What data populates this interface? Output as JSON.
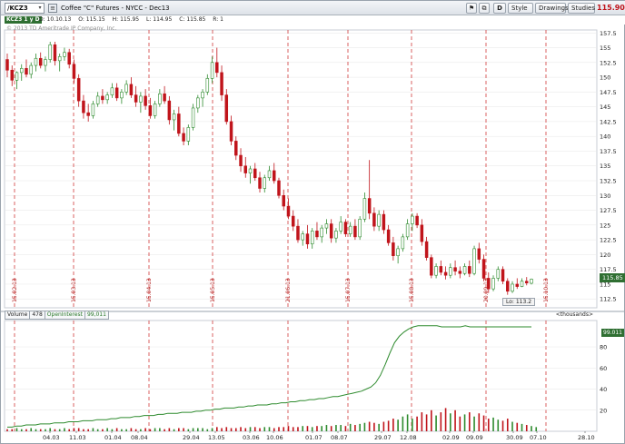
{
  "toolbar": {
    "symbol": "/KCZ3",
    "symbol_dropdown_icon": "chevron-down-icon",
    "company_icon": "company-profile-icon",
    "instrument_description": "Coffee \"C\" Futures - NYCC - Dec13",
    "d_label": "D",
    "style_label": "Style",
    "drawings_label": "Drawings",
    "studies_label": "Studies",
    "last_price": "115.90",
    "last_price_color": "#c0141b"
  },
  "quote_line": {
    "study_tag": "KCZ3 1 y D",
    "date": "D: 10.10.13",
    "open": "O: 115.15",
    "high": "H: 115.95",
    "low": "L: 114.95",
    "close": "C: 115.85",
    "range": "R: 1"
  },
  "copyright": "© 2013 TD Ameritrade IP Company, Inc.",
  "price_axis": {
    "ticks": [
      "157.5",
      "155",
      "152.5",
      "150",
      "147.5",
      "145",
      "142.5",
      "140",
      "137.5",
      "135",
      "132.5",
      "130",
      "127.5",
      "125",
      "122.5",
      "120",
      "117.5",
      "115",
      "112.5"
    ],
    "current_price_badge": "115.85",
    "low_badge": "Lo: 113.2"
  },
  "date_markers": [
    "15.02.13",
    "15.03.13",
    "15.04.13",
    "15.05.13",
    "21.06.13",
    "15.07.13",
    "15.08.13",
    "20.09.13",
    "15.10.13"
  ],
  "volume_panel": {
    "volume_label": "Volume",
    "volume_value": "478",
    "oi_label": "OpenInterest",
    "oi_value": "99,011",
    "thousands_label": "<thousands>",
    "oi_badge": "99.011",
    "y_ticks": [
      "80",
      "60",
      "40",
      "20"
    ]
  },
  "x_axis": {
    "labels": [
      "04.03",
      "11.03",
      "01.04",
      "08.04",
      "29.04",
      "13.05",
      "03.06",
      "10.06",
      "01.07",
      "08.07",
      "29.07",
      "12.08",
      "02.09",
      "09.09",
      "30.09",
      "07.10",
      "28.10"
    ]
  },
  "colors": {
    "up": "#2e8b2e",
    "down": "#c0141b",
    "oi_line": "#2e8b2e",
    "marker": "#d23a3a",
    "grid": "#e6e6e6"
  },
  "chart_data": {
    "type": "candlestick",
    "title": "Coffee \"C\" Futures - NYCC - Dec13",
    "ylim": [
      111,
      158
    ],
    "candles": [
      {
        "o": 153.0,
        "h": 154.0,
        "l": 150.0,
        "c": 151.2
      },
      {
        "o": 151.2,
        "h": 152.0,
        "l": 148.5,
        "c": 149.5
      },
      {
        "o": 149.5,
        "h": 151.0,
        "l": 148.0,
        "c": 150.8
      },
      {
        "o": 150.8,
        "h": 152.2,
        "l": 149.4,
        "c": 151.5
      },
      {
        "o": 151.5,
        "h": 153.0,
        "l": 150.0,
        "c": 150.5
      },
      {
        "o": 150.5,
        "h": 152.5,
        "l": 149.8,
        "c": 152.0
      },
      {
        "o": 152.0,
        "h": 154.0,
        "l": 151.0,
        "c": 153.2
      },
      {
        "o": 153.2,
        "h": 154.2,
        "l": 151.5,
        "c": 152.0
      },
      {
        "o": 152.0,
        "h": 153.5,
        "l": 151.0,
        "c": 153.0
      },
      {
        "o": 153.0,
        "h": 156.0,
        "l": 152.5,
        "c": 155.5
      },
      {
        "o": 155.5,
        "h": 156.0,
        "l": 152.0,
        "c": 152.8
      },
      {
        "o": 152.8,
        "h": 154.0,
        "l": 151.0,
        "c": 153.5
      },
      {
        "o": 153.5,
        "h": 155.0,
        "l": 152.8,
        "c": 154.2
      },
      {
        "o": 154.2,
        "h": 154.8,
        "l": 151.5,
        "c": 152.2
      },
      {
        "o": 152.2,
        "h": 153.0,
        "l": 149.0,
        "c": 149.8
      },
      {
        "o": 149.8,
        "h": 150.5,
        "l": 145.0,
        "c": 146.0
      },
      {
        "o": 146.0,
        "h": 147.0,
        "l": 143.0,
        "c": 144.0
      },
      {
        "o": 144.0,
        "h": 145.5,
        "l": 142.5,
        "c": 143.5
      },
      {
        "o": 143.5,
        "h": 146.0,
        "l": 143.0,
        "c": 145.5
      },
      {
        "o": 145.5,
        "h": 147.5,
        "l": 145.0,
        "c": 146.8
      },
      {
        "o": 146.8,
        "h": 148.0,
        "l": 145.5,
        "c": 146.2
      },
      {
        "o": 146.2,
        "h": 147.5,
        "l": 145.5,
        "c": 147.0
      },
      {
        "o": 147.0,
        "h": 149.0,
        "l": 146.5,
        "c": 148.2
      },
      {
        "o": 148.2,
        "h": 149.0,
        "l": 146.0,
        "c": 146.5
      },
      {
        "o": 146.5,
        "h": 148.0,
        "l": 145.5,
        "c": 147.5
      },
      {
        "o": 147.5,
        "h": 149.5,
        "l": 147.0,
        "c": 148.8
      },
      {
        "o": 148.8,
        "h": 150.0,
        "l": 146.5,
        "c": 147.0
      },
      {
        "o": 147.0,
        "h": 148.5,
        "l": 145.0,
        "c": 145.8
      },
      {
        "o": 145.8,
        "h": 147.5,
        "l": 144.0,
        "c": 146.8
      },
      {
        "o": 146.8,
        "h": 148.0,
        "l": 144.5,
        "c": 145.2
      },
      {
        "o": 145.2,
        "h": 146.5,
        "l": 143.0,
        "c": 143.5
      },
      {
        "o": 143.5,
        "h": 146.0,
        "l": 143.0,
        "c": 145.5
      },
      {
        "o": 145.5,
        "h": 148.0,
        "l": 145.0,
        "c": 147.2
      },
      {
        "o": 147.2,
        "h": 148.5,
        "l": 145.5,
        "c": 146.0
      },
      {
        "o": 146.0,
        "h": 146.8,
        "l": 142.0,
        "c": 142.8
      },
      {
        "o": 142.8,
        "h": 144.5,
        "l": 141.0,
        "c": 143.8
      },
      {
        "o": 143.8,
        "h": 145.0,
        "l": 140.0,
        "c": 140.5
      },
      {
        "o": 140.5,
        "h": 141.5,
        "l": 138.5,
        "c": 139.2
      },
      {
        "o": 139.2,
        "h": 142.0,
        "l": 138.5,
        "c": 141.5
      },
      {
        "o": 141.5,
        "h": 145.5,
        "l": 141.0,
        "c": 144.8
      },
      {
        "o": 144.8,
        "h": 147.0,
        "l": 144.0,
        "c": 146.5
      },
      {
        "o": 146.5,
        "h": 148.0,
        "l": 145.0,
        "c": 147.5
      },
      {
        "o": 147.5,
        "h": 150.5,
        "l": 147.0,
        "c": 149.8
      },
      {
        "o": 149.8,
        "h": 153.5,
        "l": 149.0,
        "c": 152.5
      },
      {
        "o": 152.5,
        "h": 155.0,
        "l": 150.0,
        "c": 150.8
      },
      {
        "o": 150.8,
        "h": 152.0,
        "l": 146.0,
        "c": 147.0
      },
      {
        "o": 147.0,
        "h": 148.0,
        "l": 142.0,
        "c": 142.5
      },
      {
        "o": 142.5,
        "h": 143.5,
        "l": 138.5,
        "c": 139.2
      },
      {
        "o": 139.2,
        "h": 140.0,
        "l": 136.0,
        "c": 136.8
      },
      {
        "o": 136.8,
        "h": 138.0,
        "l": 134.0,
        "c": 135.0
      },
      {
        "o": 135.0,
        "h": 136.5,
        "l": 133.0,
        "c": 133.8
      },
      {
        "o": 133.8,
        "h": 135.0,
        "l": 132.0,
        "c": 134.5
      },
      {
        "o": 134.5,
        "h": 135.5,
        "l": 132.5,
        "c": 133.0
      },
      {
        "o": 133.0,
        "h": 134.0,
        "l": 130.5,
        "c": 131.2
      },
      {
        "o": 131.2,
        "h": 133.5,
        "l": 130.5,
        "c": 133.0
      },
      {
        "o": 133.0,
        "h": 135.0,
        "l": 132.5,
        "c": 134.2
      },
      {
        "o": 134.2,
        "h": 135.5,
        "l": 132.0,
        "c": 132.5
      },
      {
        "o": 132.5,
        "h": 133.0,
        "l": 129.5,
        "c": 130.0
      },
      {
        "o": 130.0,
        "h": 131.0,
        "l": 127.5,
        "c": 128.2
      },
      {
        "o": 128.2,
        "h": 129.5,
        "l": 126.0,
        "c": 126.5
      },
      {
        "o": 126.5,
        "h": 127.5,
        "l": 124.0,
        "c": 124.8
      },
      {
        "o": 124.8,
        "h": 126.0,
        "l": 122.0,
        "c": 122.5
      },
      {
        "o": 122.5,
        "h": 124.0,
        "l": 121.5,
        "c": 123.5
      },
      {
        "o": 123.5,
        "h": 125.0,
        "l": 121.0,
        "c": 121.8
      },
      {
        "o": 121.8,
        "h": 124.5,
        "l": 121.0,
        "c": 124.0
      },
      {
        "o": 124.0,
        "h": 125.5,
        "l": 122.5,
        "c": 123.0
      },
      {
        "o": 123.0,
        "h": 125.0,
        "l": 122.0,
        "c": 124.5
      },
      {
        "o": 124.5,
        "h": 126.0,
        "l": 123.5,
        "c": 125.2
      },
      {
        "o": 125.2,
        "h": 126.0,
        "l": 122.0,
        "c": 122.8
      },
      {
        "o": 122.8,
        "h": 124.5,
        "l": 122.0,
        "c": 124.0
      },
      {
        "o": 124.0,
        "h": 126.5,
        "l": 123.5,
        "c": 125.5
      },
      {
        "o": 125.5,
        "h": 126.0,
        "l": 123.0,
        "c": 123.5
      },
      {
        "o": 123.5,
        "h": 125.5,
        "l": 123.0,
        "c": 124.8
      },
      {
        "o": 124.8,
        "h": 126.0,
        "l": 122.5,
        "c": 123.0
      },
      {
        "o": 123.0,
        "h": 126.5,
        "l": 122.5,
        "c": 126.0
      },
      {
        "o": 126.0,
        "h": 130.5,
        "l": 125.5,
        "c": 129.5
      },
      {
        "o": 129.5,
        "h": 136.0,
        "l": 126.0,
        "c": 127.0
      },
      {
        "o": 127.0,
        "h": 128.0,
        "l": 124.0,
        "c": 124.8
      },
      {
        "o": 124.8,
        "h": 127.5,
        "l": 124.0,
        "c": 126.8
      },
      {
        "o": 126.8,
        "h": 127.5,
        "l": 123.5,
        "c": 124.2
      },
      {
        "o": 124.2,
        "h": 125.0,
        "l": 121.5,
        "c": 122.0
      },
      {
        "o": 122.0,
        "h": 123.0,
        "l": 119.0,
        "c": 119.8
      },
      {
        "o": 119.8,
        "h": 121.5,
        "l": 118.5,
        "c": 121.0
      },
      {
        "o": 121.0,
        "h": 123.5,
        "l": 120.5,
        "c": 123.0
      },
      {
        "o": 123.0,
        "h": 126.0,
        "l": 122.5,
        "c": 125.2
      },
      {
        "o": 125.2,
        "h": 127.0,
        "l": 124.0,
        "c": 126.5
      },
      {
        "o": 126.5,
        "h": 127.0,
        "l": 124.5,
        "c": 125.0
      },
      {
        "o": 125.0,
        "h": 126.0,
        "l": 121.5,
        "c": 122.2
      },
      {
        "o": 122.2,
        "h": 123.0,
        "l": 119.0,
        "c": 119.5
      },
      {
        "o": 119.5,
        "h": 120.0,
        "l": 116.0,
        "c": 116.5
      },
      {
        "o": 116.5,
        "h": 118.5,
        "l": 116.0,
        "c": 118.0
      },
      {
        "o": 118.0,
        "h": 119.0,
        "l": 116.5,
        "c": 117.0
      },
      {
        "o": 117.0,
        "h": 118.0,
        "l": 115.8,
        "c": 116.5
      },
      {
        "o": 116.5,
        "h": 118.5,
        "l": 116.0,
        "c": 117.8
      },
      {
        "o": 117.8,
        "h": 119.0,
        "l": 116.5,
        "c": 117.2
      },
      {
        "o": 117.2,
        "h": 118.0,
        "l": 116.0,
        "c": 116.8
      },
      {
        "o": 116.8,
        "h": 118.5,
        "l": 116.5,
        "c": 118.0
      },
      {
        "o": 118.0,
        "h": 119.0,
        "l": 116.2,
        "c": 116.8
      },
      {
        "o": 116.8,
        "h": 121.5,
        "l": 116.5,
        "c": 121.0
      },
      {
        "o": 121.0,
        "h": 122.0,
        "l": 118.5,
        "c": 119.2
      },
      {
        "o": 119.2,
        "h": 120.0,
        "l": 115.5,
        "c": 116.0
      },
      {
        "o": 116.0,
        "h": 117.0,
        "l": 113.5,
        "c": 114.2
      },
      {
        "o": 114.2,
        "h": 116.5,
        "l": 113.8,
        "c": 116.0
      },
      {
        "o": 116.0,
        "h": 118.0,
        "l": 115.5,
        "c": 117.5
      },
      {
        "o": 117.5,
        "h": 118.0,
        "l": 115.0,
        "c": 115.5
      },
      {
        "o": 115.5,
        "h": 116.0,
        "l": 113.2,
        "c": 113.8
      },
      {
        "o": 113.8,
        "h": 115.5,
        "l": 113.5,
        "c": 115.0
      },
      {
        "o": 115.0,
        "h": 116.0,
        "l": 114.2,
        "c": 114.6
      },
      {
        "o": 114.6,
        "h": 116.0,
        "l": 114.5,
        "c": 115.5
      },
      {
        "o": 115.5,
        "h": 116.2,
        "l": 114.8,
        "c": 115.2
      },
      {
        "o": 115.15,
        "h": 115.95,
        "l": 114.95,
        "c": 115.85
      }
    ],
    "volume_ylim": [
      0,
      105
    ],
    "volume": [
      2,
      2,
      3,
      2,
      2,
      3,
      2,
      2,
      2,
      3,
      2,
      2,
      3,
      2,
      3,
      3,
      2,
      2,
      3,
      2,
      2,
      3,
      2,
      3,
      2,
      2,
      3,
      2,
      2,
      3,
      2,
      3,
      3,
      2,
      3,
      2,
      3,
      3,
      2,
      3,
      3,
      3,
      2,
      3,
      4,
      3,
      4,
      3,
      3,
      4,
      3,
      4,
      4,
      3,
      4,
      4,
      3,
      4,
      4,
      5,
      4,
      4,
      5,
      5,
      4,
      5,
      5,
      6,
      5,
      6,
      6,
      5,
      7,
      6,
      7,
      8,
      9,
      8,
      7,
      9,
      10,
      12,
      11,
      14,
      16,
      12,
      14,
      18,
      16,
      20,
      15,
      18,
      22,
      17,
      20,
      14,
      16,
      18,
      14,
      17,
      15,
      12,
      13,
      11,
      10,
      12,
      9,
      8,
      7,
      6,
      5,
      4
    ],
    "open_interest": [
      4,
      4,
      5,
      5,
      6,
      6,
      6,
      7,
      7,
      7,
      8,
      8,
      8,
      9,
      9,
      9,
      10,
      10,
      10,
      11,
      11,
      11,
      12,
      12,
      13,
      13,
      13,
      14,
      14,
      15,
      15,
      15,
      16,
      16,
      17,
      17,
      17,
      18,
      18,
      18,
      19,
      19,
      20,
      20,
      21,
      21,
      22,
      22,
      22,
      23,
      23,
      24,
      24,
      25,
      25,
      25,
      26,
      26,
      27,
      27,
      28,
      28,
      29,
      29,
      30,
      30,
      31,
      31,
      32,
      33,
      33,
      34,
      35,
      36,
      37,
      38,
      40,
      42,
      46,
      53,
      63,
      74,
      84,
      90,
      94,
      97,
      99,
      100,
      100,
      100,
      100,
      100,
      99,
      99,
      99,
      99,
      99,
      100,
      99,
      99,
      99,
      99,
      99,
      99,
      99,
      99,
      99,
      99,
      99,
      99,
      99,
      99
    ],
    "price_ticks": [
      157.5,
      155,
      152.5,
      150,
      147.5,
      145,
      142.5,
      140,
      137.5,
      135,
      132.5,
      130,
      127.5,
      125,
      122.5,
      120,
      117.5,
      115,
      112.5
    ]
  }
}
